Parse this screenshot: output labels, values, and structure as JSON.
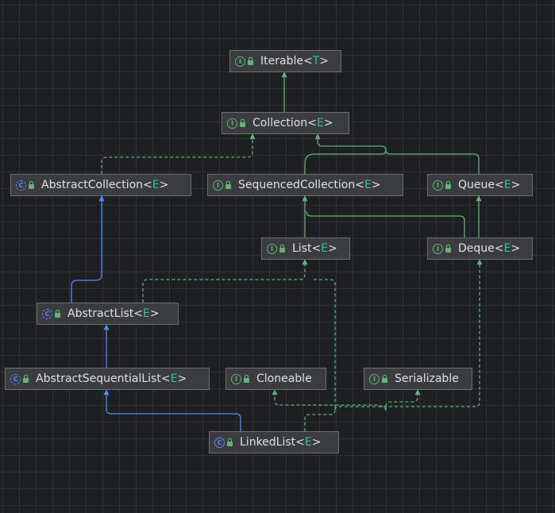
{
  "nodes": {
    "iterable": {
      "name": "Iterable",
      "type_param": "T",
      "kind": "interface"
    },
    "collection": {
      "name": "Collection",
      "type_param": "E",
      "kind": "interface"
    },
    "abstract_collection": {
      "name": "AbstractCollection",
      "type_param": "E",
      "kind": "abstract-class"
    },
    "sequenced_collection": {
      "name": "SequencedCollection",
      "type_param": "E",
      "kind": "interface"
    },
    "queue": {
      "name": "Queue",
      "type_param": "E",
      "kind": "interface"
    },
    "list": {
      "name": "List",
      "type_param": "E",
      "kind": "interface"
    },
    "deque": {
      "name": "Deque",
      "type_param": "E",
      "kind": "interface"
    },
    "abstract_list": {
      "name": "AbstractList",
      "type_param": "E",
      "kind": "abstract-class"
    },
    "abstract_sequential_list": {
      "name": "AbstractSequentialList",
      "type_param": "E",
      "kind": "abstract-class"
    },
    "cloneable": {
      "name": "Cloneable",
      "type_param": "",
      "kind": "interface"
    },
    "serializable": {
      "name": "Serializable",
      "type_param": "",
      "kind": "interface"
    },
    "linked_list": {
      "name": "LinkedList",
      "type_param": "E",
      "kind": "class"
    }
  },
  "kind_glyphs": {
    "interface": "I",
    "abstract-class": "C",
    "class": "C"
  },
  "colors": {
    "background": "#1e1f22",
    "grid": "#2f3136",
    "node_fill": "#3a3c40",
    "node_border": "#6b6e73",
    "interface_accent": "#5fb573",
    "class_accent": "#548af7",
    "extends_edge": "#548af7",
    "interface_edge": "#5fb573",
    "type_param": "#2fbfa3",
    "text": "#dfe1e5"
  }
}
